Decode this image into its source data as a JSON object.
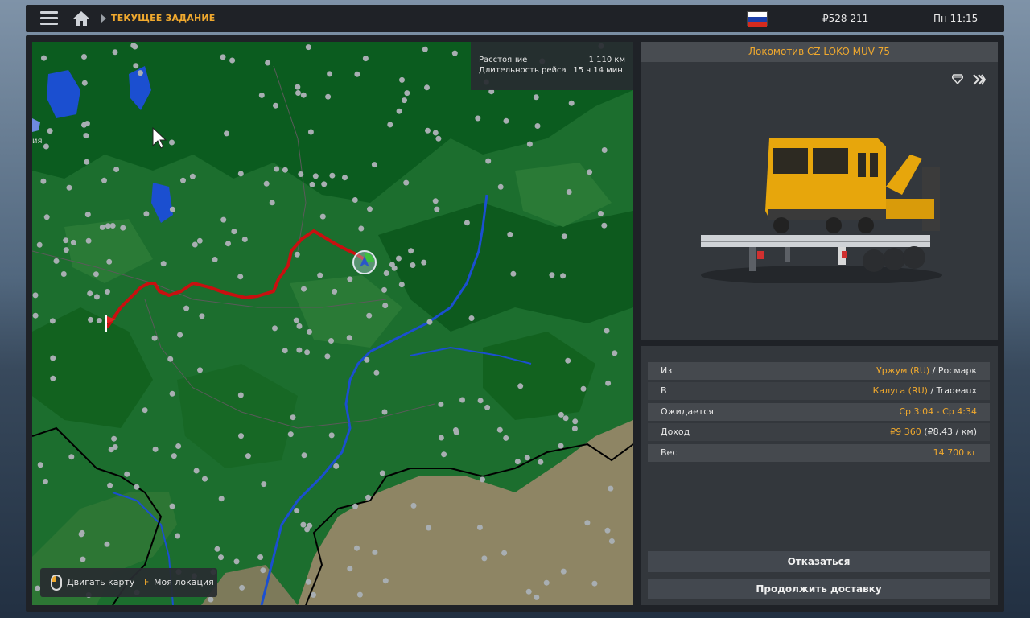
{
  "header": {
    "breadcrumb": "ТЕКУЩЕЕ ЗАДАНИЕ",
    "money": "₽528 211",
    "time": "Пн 11:15",
    "flag_colors": [
      "#ffffff",
      "#1c3fa8",
      "#d52b1e"
    ]
  },
  "map": {
    "region_label": "ия",
    "stats": {
      "distance_label": "Расстояние",
      "distance_value": "1 110 км",
      "duration_label": "Длительность рейса",
      "duration_value": "15 ч 14 мин."
    },
    "controls": {
      "move_label": "Двигать карту",
      "location_key": "F",
      "location_label": "Моя локация"
    },
    "colors": {
      "forest": "#1c6e2e",
      "dense_forest": "#0d5a1e",
      "field": "#8a8060",
      "water": "#1b4fd0",
      "route": "#c81010"
    }
  },
  "cargo": {
    "title": "Локомотив CZ LOKO MUV 75",
    "icons": [
      "gem-icon",
      "fast-forward-icon"
    ]
  },
  "details": {
    "from_label": "Из",
    "from_city": "Уржум (RU)",
    "from_company": " / Росмарк",
    "to_label": "В",
    "to_city": "Калуга (RU)",
    "to_company": " / Tradeaux",
    "expected_label": "Ожидается",
    "expected_value": "Ср 3:04 - Ср 4:34",
    "income_label": "Доход",
    "income_value": "₽9 360",
    "income_rate": " (₽8,43 / км)",
    "weight_label": "Вес",
    "weight_value": "14 700 кг"
  },
  "actions": {
    "cancel_label": "Отказаться",
    "continue_label": "Продолжить доставку"
  }
}
